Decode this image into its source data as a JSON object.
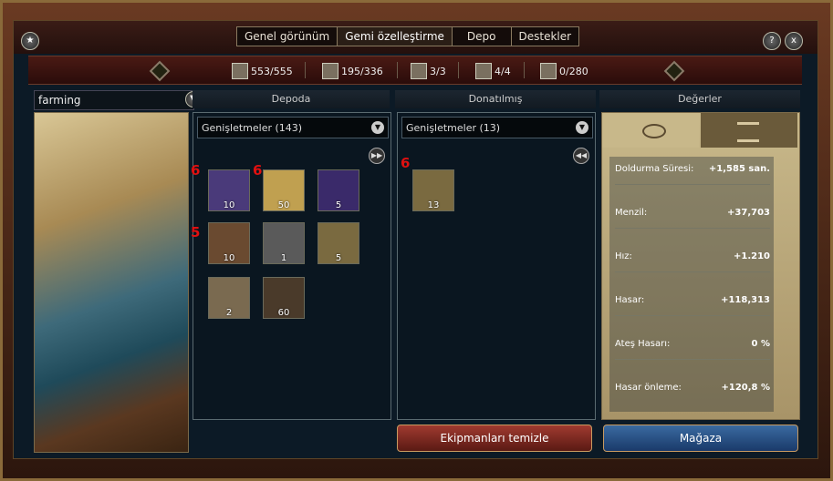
{
  "tabs": [
    {
      "label": "Genel görünüm"
    },
    {
      "label": "Gemi özelleştirme"
    },
    {
      "label": "Depo"
    },
    {
      "label": "Destekler"
    }
  ],
  "buttons": {
    "help": "?",
    "close": "x"
  },
  "resources": [
    {
      "icon": "cannon-icon",
      "value": "553/555"
    },
    {
      "icon": "crossed-swords-icon",
      "value": "195/336"
    },
    {
      "icon": "officer-icon",
      "value": "3/3"
    },
    {
      "icon": "flag-icon",
      "value": "4/4"
    },
    {
      "icon": "cargo-icon",
      "value": "0/280"
    }
  ],
  "ship": {
    "name": "farming"
  },
  "headers": {
    "storage": "Depoda",
    "equipped": "Donatılmış",
    "values": "Değerler"
  },
  "storage": {
    "dropdown": "Genişletmeler (143)",
    "items": [
      {
        "count": "10",
        "color": "#4a3a7a"
      },
      {
        "count": "50",
        "color": "#c0a050"
      },
      {
        "count": "5",
        "color": "#3a2a6a"
      },
      {
        "count": "10",
        "color": "#6a4a30"
      },
      {
        "count": "1",
        "color": "#5a5a5a"
      },
      {
        "count": "5",
        "color": "#7a6a40"
      },
      {
        "count": "2",
        "color": "#7a6a50"
      },
      {
        "count": "60",
        "color": "#4a3a2a"
      }
    ],
    "badges": [
      {
        "text": "6"
      },
      {
        "text": "6"
      },
      {
        "text": "5"
      }
    ]
  },
  "equipped": {
    "dropdown": "Genişletmeler (13)",
    "items": [
      {
        "count": "13",
        "color": "#7a6a40"
      }
    ],
    "badges": [
      {
        "text": "6"
      }
    ]
  },
  "values": [
    {
      "label": "Doldurma Süresi:",
      "value": "+1,585 san."
    },
    {
      "label": "Menzil:",
      "value": "+37,703"
    },
    {
      "label": "Hız:",
      "value": "+1.210"
    },
    {
      "label": "Hasar:",
      "value": "+118,313"
    },
    {
      "label": "Ateş Hasarı:",
      "value": "0 %"
    },
    {
      "label": "Hasar önleme:",
      "value": "+120,8 %"
    }
  ],
  "actions": {
    "clear": "Ekipmanları temizle",
    "shop": "Mağaza"
  }
}
